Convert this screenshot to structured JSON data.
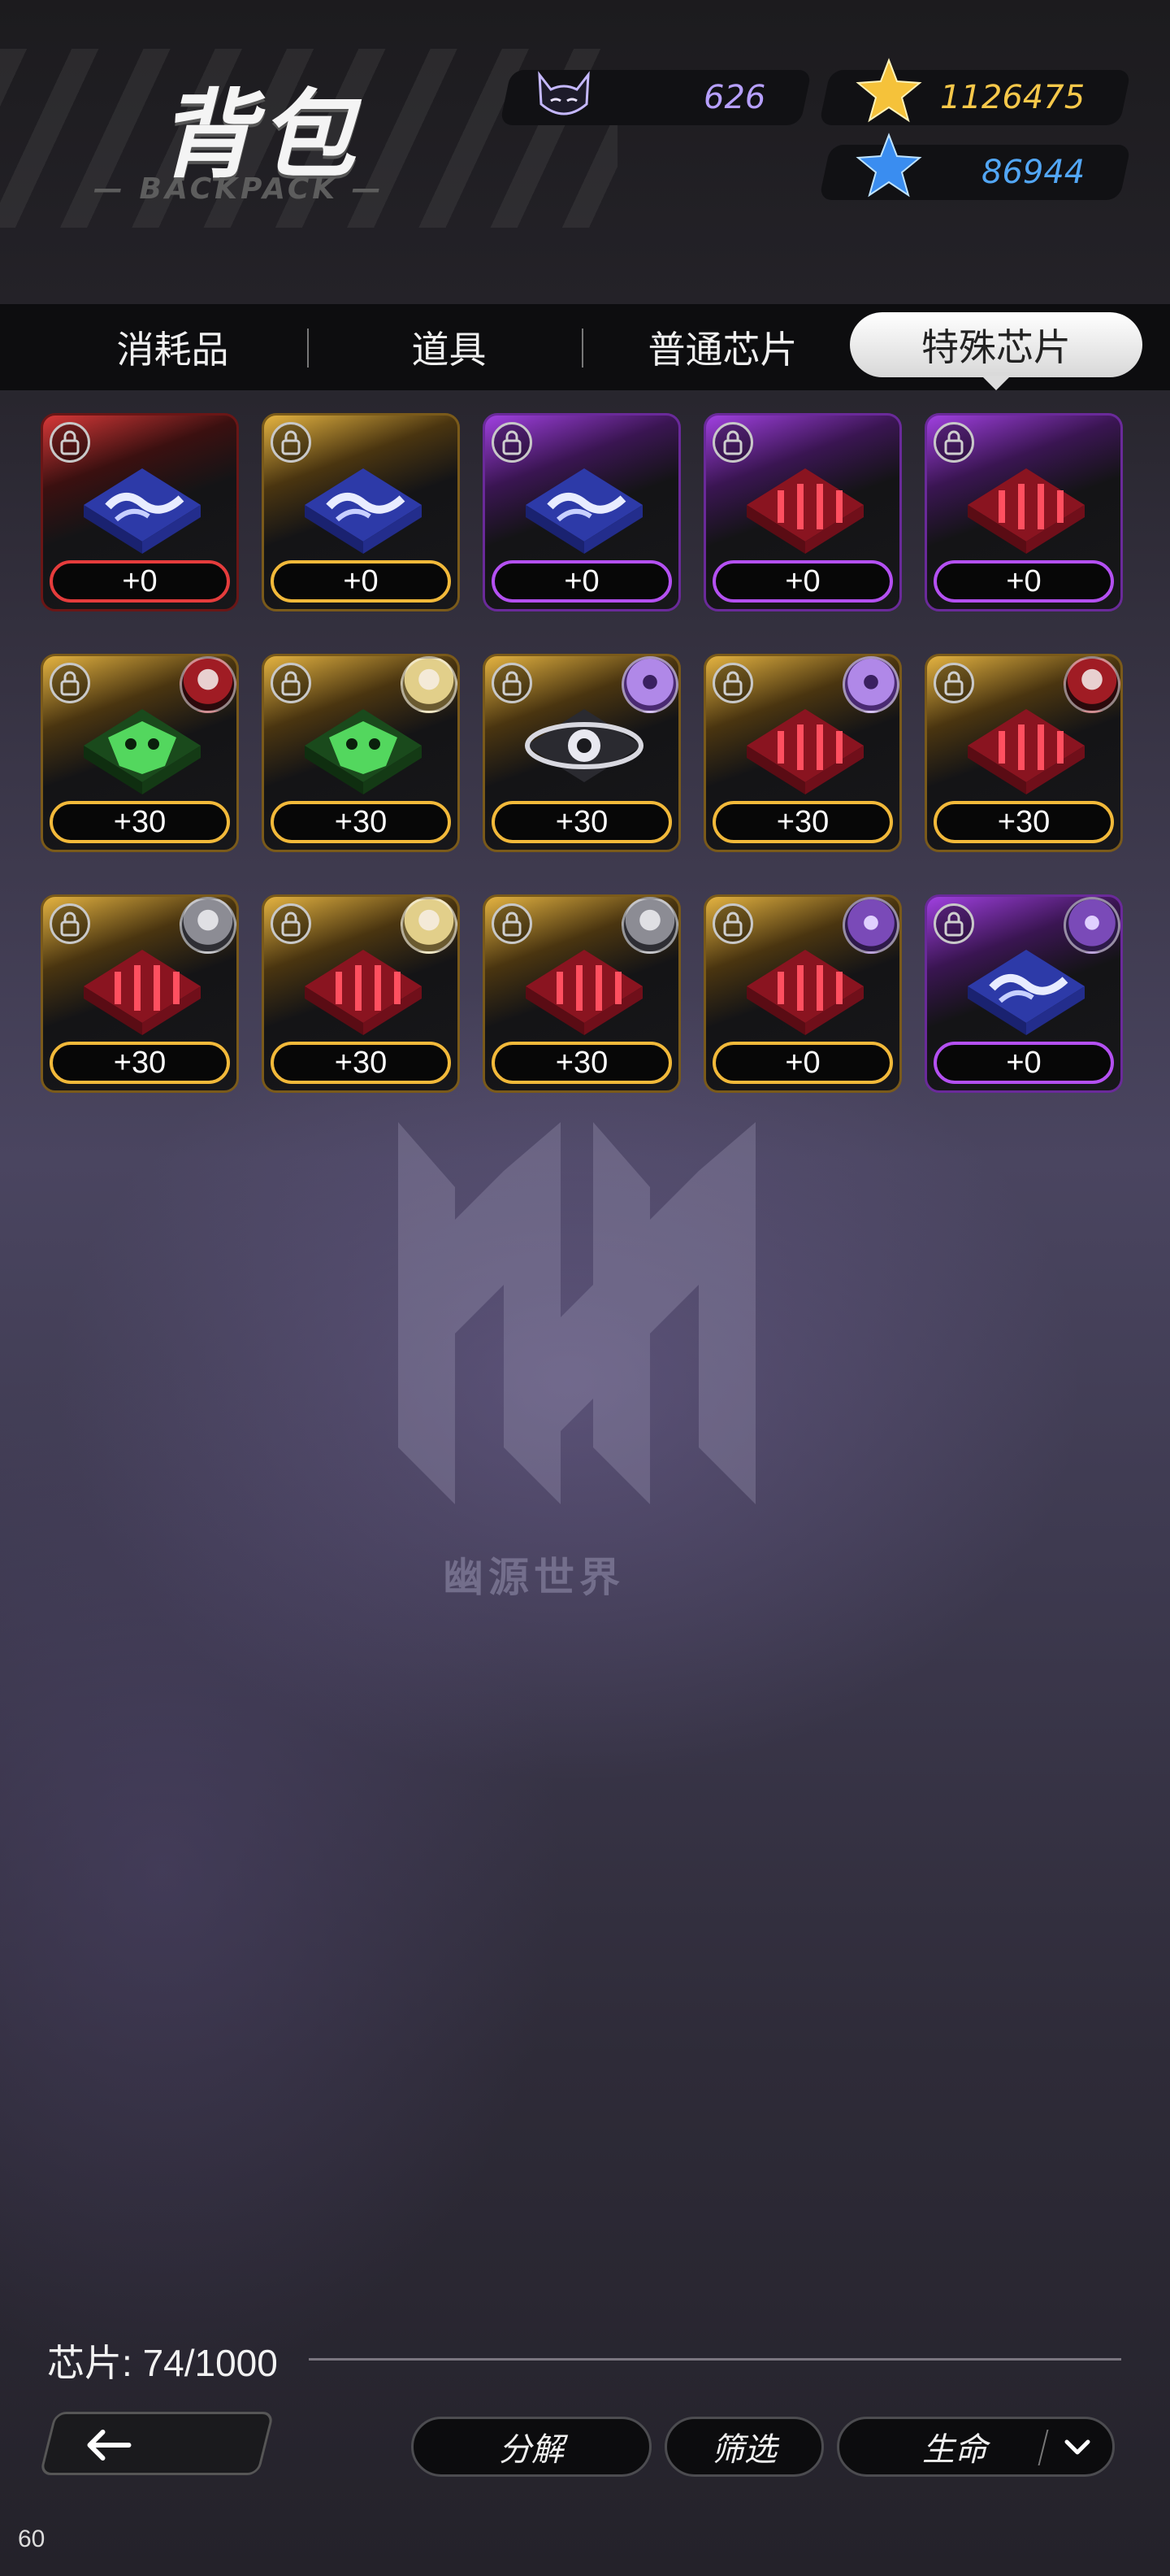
{
  "header": {
    "title": "背包",
    "subtitle": "BACKPACK"
  },
  "currencies": [
    {
      "name": "cat-token",
      "icon": "cat-face-icon",
      "value": "626",
      "color": "#b7a0ff"
    },
    {
      "name": "gold-star",
      "icon": "gold-star-icon",
      "value": "1126475",
      "color": "#f7c84a"
    },
    {
      "name": "blue-star",
      "icon": "blue-star-icon",
      "value": "86944",
      "color": "#52a6f5"
    }
  ],
  "tabs": [
    {
      "label": "消耗品",
      "active": false
    },
    {
      "label": "道具",
      "active": false
    },
    {
      "label": "普通芯片",
      "active": false
    },
    {
      "label": "特殊芯片",
      "active": true
    }
  ],
  "items": [
    {
      "rarity": "red",
      "chip": "wave-chip-icon",
      "level": "+0",
      "avatar": null
    },
    {
      "rarity": "gold",
      "chip": "wave-chip-icon",
      "level": "+0",
      "avatar": null
    },
    {
      "rarity": "purple",
      "chip": "wave-chip-icon",
      "level": "+0",
      "avatar": null
    },
    {
      "rarity": "purple",
      "chip": "bars-chip-icon",
      "level": "+0",
      "avatar": null
    },
    {
      "rarity": "purple",
      "chip": "bars-chip-icon",
      "level": "+0",
      "avatar": null
    },
    {
      "rarity": "gold",
      "chip": "green-mask-chip-icon",
      "level": "+30",
      "avatar": "character-avatar-red"
    },
    {
      "rarity": "gold",
      "chip": "green-mask-chip-icon",
      "level": "+30",
      "avatar": "character-avatar-blonde"
    },
    {
      "rarity": "gold",
      "chip": "eye-chip-icon",
      "level": "+30",
      "avatar": "character-avatar-purple-ghost"
    },
    {
      "rarity": "gold",
      "chip": "bars-chip-icon",
      "level": "+30",
      "avatar": "character-avatar-purple-ghost"
    },
    {
      "rarity": "gold",
      "chip": "bars-chip-icon",
      "level": "+30",
      "avatar": "character-avatar-red"
    },
    {
      "rarity": "gold",
      "chip": "bars-chip-icon",
      "level": "+30",
      "avatar": "character-avatar-grey"
    },
    {
      "rarity": "gold",
      "chip": "bars-chip-icon",
      "level": "+30",
      "avatar": "character-avatar-blonde"
    },
    {
      "rarity": "gold",
      "chip": "bars-chip-icon",
      "level": "+30",
      "avatar": "character-avatar-grey"
    },
    {
      "rarity": "gold",
      "chip": "bars-chip-icon",
      "level": "+0",
      "avatar": "character-avatar-purple-mech"
    },
    {
      "rarity": "purple",
      "chip": "wave-chip-icon",
      "level": "+0",
      "avatar": "character-avatar-purple-mech"
    }
  ],
  "watermark": {
    "text": "幽源世界"
  },
  "footer": {
    "capacity_label": "芯片:",
    "capacity_value": "74/1000",
    "decompose_label": "分解",
    "filter_label": "筛选",
    "sort_label": "生命",
    "back_icon": "back-arrow-icon",
    "dropdown_icon": "chevron-down-icon"
  },
  "fps": "60"
}
